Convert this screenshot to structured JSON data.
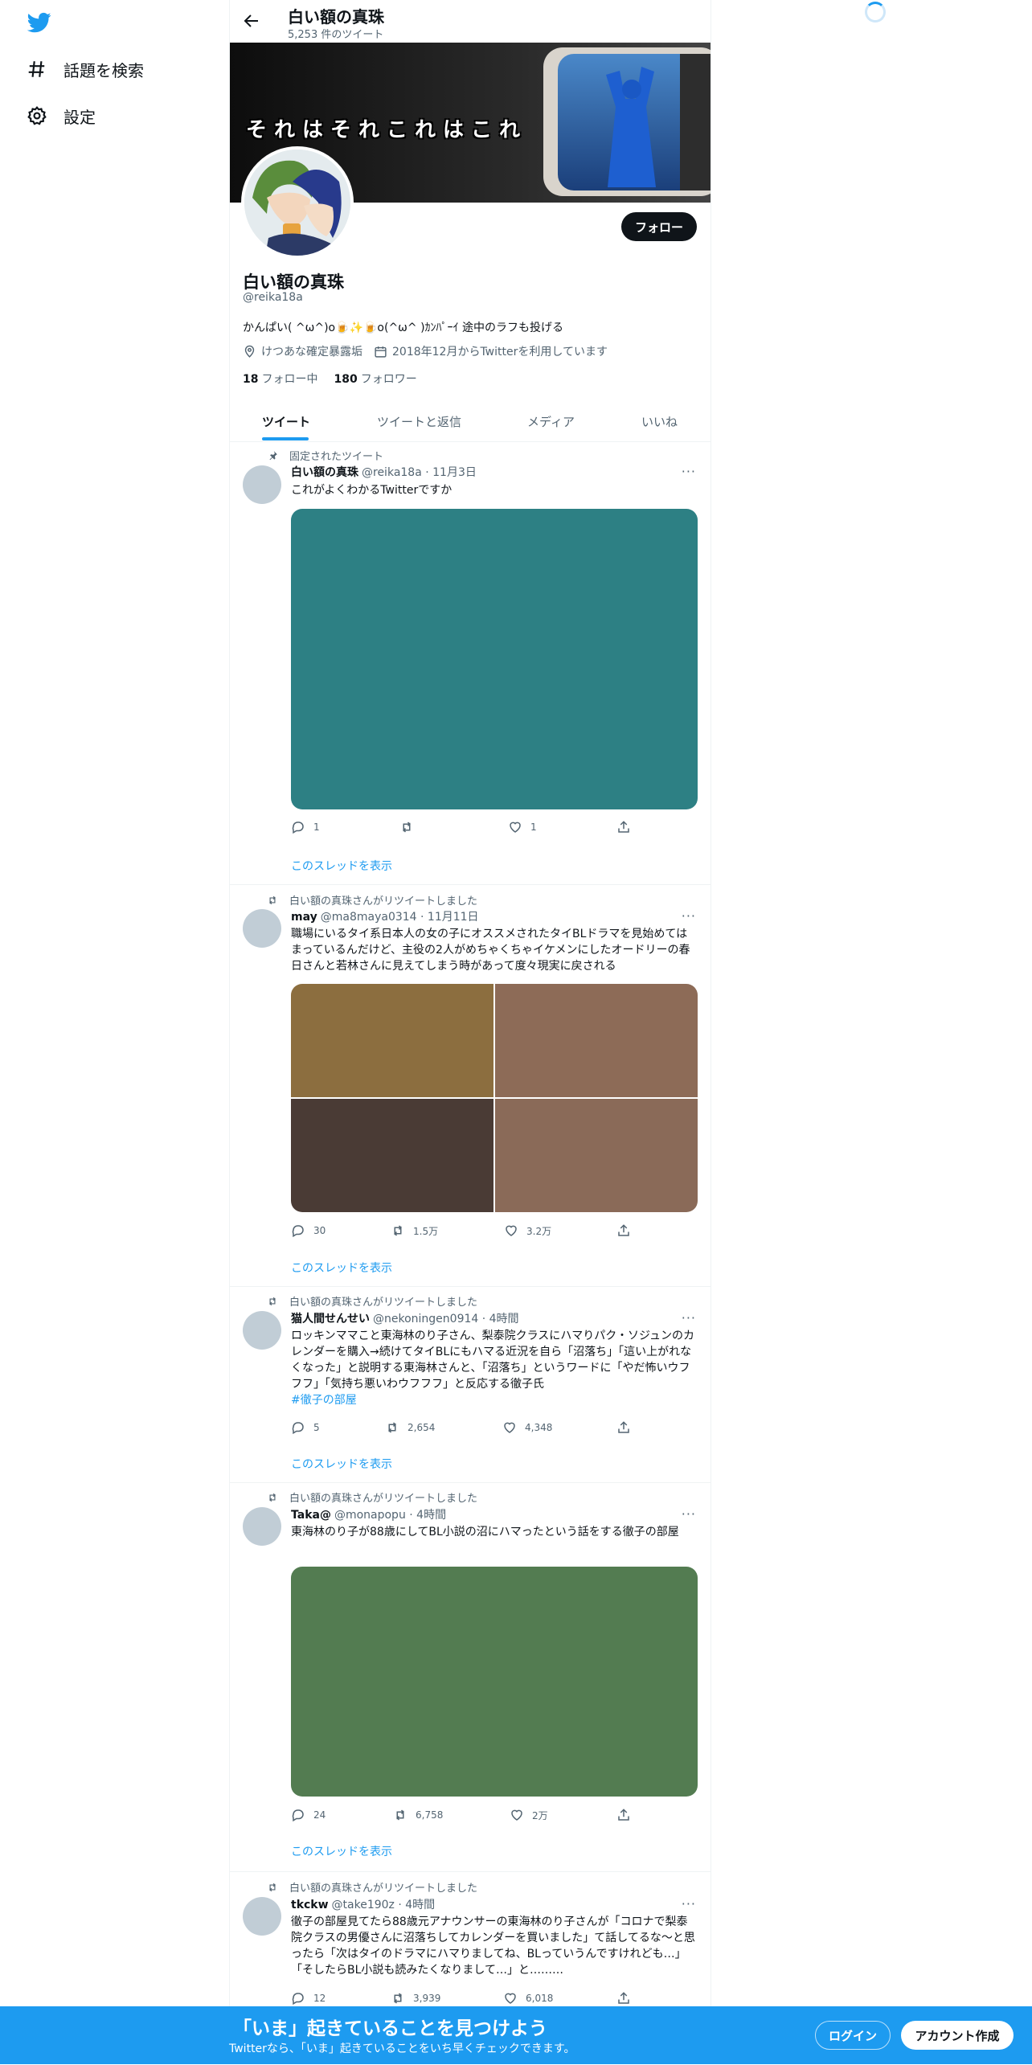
{
  "sidebar": {
    "items": [
      {
        "label": "話題を検索",
        "icon": "hashtag-icon"
      },
      {
        "label": "設定",
        "icon": "gear-icon"
      }
    ]
  },
  "header": {
    "title": "白い額の真珠",
    "tweet_count": "5,253 件のツイート"
  },
  "banner": {
    "text": "それはそれこれはこれ"
  },
  "profile": {
    "name": "白い額の真珠",
    "handle": "@reika18a",
    "bio": "かんぱい( ^ω^)o🍺✨🍺o(^ω^ )ｶﾝﾊﾟｰｲ 途中のラフも投げる",
    "location": "けつあな確定暴露垢",
    "joined": "2018年12月からTwitterを利用しています",
    "following_count": "18",
    "following_label": "フォロー中",
    "followers_count": "180",
    "followers_label": "フォロワー",
    "follow_button": "フォロー"
  },
  "tabs": [
    "ツイート",
    "ツイートと返信",
    "メディア",
    "いいね"
  ],
  "tweets": [
    {
      "context": "固定されたツイート",
      "name": "白い額の真珠",
      "meta": "@reika18a · 11月3日",
      "text": "これがよくわかるTwitterですか",
      "replies": "1",
      "retweets": "",
      "likes": "1",
      "thread": "このスレッドを表示"
    },
    {
      "context": "白い額の真珠さんがリツイートしました",
      "name": "may",
      "meta": "@ma8maya0314 · 11月11日",
      "text": "職場にいるタイ系日本人の女の子にオススメされたタイBLドラマを見始めてはまっているんだけど、主役の2人がめちゃくちゃイケメンにしたオードリーの春日さんと若林さんに見えてしまう時があって度々現実に戻される",
      "replies": "30",
      "retweets": "1.5万",
      "likes": "3.2万",
      "thread": "このスレッドを表示"
    },
    {
      "context": "白い額の真珠さんがリツイートしました",
      "name": "猫人間せんせい",
      "meta": "@nekoningen0914 · 4時間",
      "text": "ロッキンママこと東海林のり子さん、梨泰院クラスにハマりパク・ソジュンのカレンダーを購入→続けてタイBLにもハマる近況を自ら「沼落ち」「這い上がれなくなった」と説明する東海林さんと、「沼落ち」というワードに「やだ怖いウフフフ」「気持ち悪いわウフフフ」と反応する徹子氏",
      "hashtag": "#徹子の部屋",
      "replies": "5",
      "retweets": "2,654",
      "likes": "4,348",
      "thread": "このスレッドを表示"
    },
    {
      "context": "白い額の真珠さんがリツイートしました",
      "name": "Taka@",
      "meta": "@monapopu · 4時間",
      "text": "東海林のり子が88歳にしてBL小説の沼にハマったという話をする徹子の部屋",
      "replies": "24",
      "retweets": "6,758",
      "likes": "2万",
      "thread": "このスレッドを表示"
    },
    {
      "context": "白い額の真珠さんがリツイートしました",
      "name": "tkckw",
      "meta": "@take190z · 4時間",
      "text": "徹子の部屋見てたら88歳元アナウンサーの東海林のり子さんが「コロナで梨泰院クラスの男優さんに沼落ちしてカレンダーを買いました」て話してるな〜と思ったら「次はタイのドラマにハマりましてね、BLっていうんですけれども…」「そしたらBL小説も読みたくなりまして…」と………",
      "replies": "12",
      "retweets": "3,939",
      "likes": "6,018"
    }
  ],
  "bottom_bar": {
    "title": "「いま」起きていることを見つけよう",
    "subtitle": "Twitterなら、「いま」起きていることをいち早くチェックできます。",
    "login": "ログイン",
    "signup": "アカウント作成"
  },
  "colors": {
    "accent": "#1d9bf0",
    "text": "#0f1419",
    "muted": "#536471"
  }
}
